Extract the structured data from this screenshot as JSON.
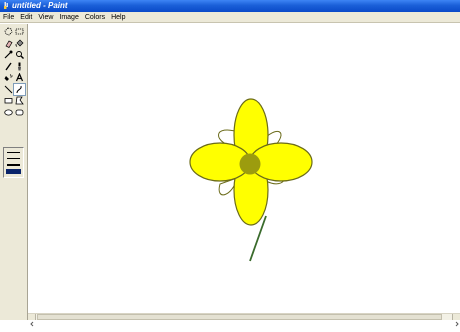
{
  "window": {
    "title": "untitled - Paint"
  },
  "menu": [
    "File",
    "Edit",
    "View",
    "Image",
    "Colors",
    "Help"
  ],
  "tools": [
    "free-form-select-icon",
    "rectangle-select-icon",
    "eraser-icon",
    "fill-bucket-icon",
    "pick-color-icon",
    "magnifier-icon",
    "pencil-icon",
    "brush-icon",
    "airbrush-icon",
    "text-icon",
    "line-icon",
    "curve-icon",
    "rectangle-icon",
    "polygon-icon",
    "ellipse-icon",
    "rounded-rectangle-icon"
  ],
  "colors": {
    "petal_fill": "#ffff00",
    "petal_outline": "#6b6b1a",
    "center_fill": "#9c9c0e",
    "stem": "#3a6b2c",
    "title_bar": "#0a49c8",
    "chrome": "#ece9d8"
  }
}
